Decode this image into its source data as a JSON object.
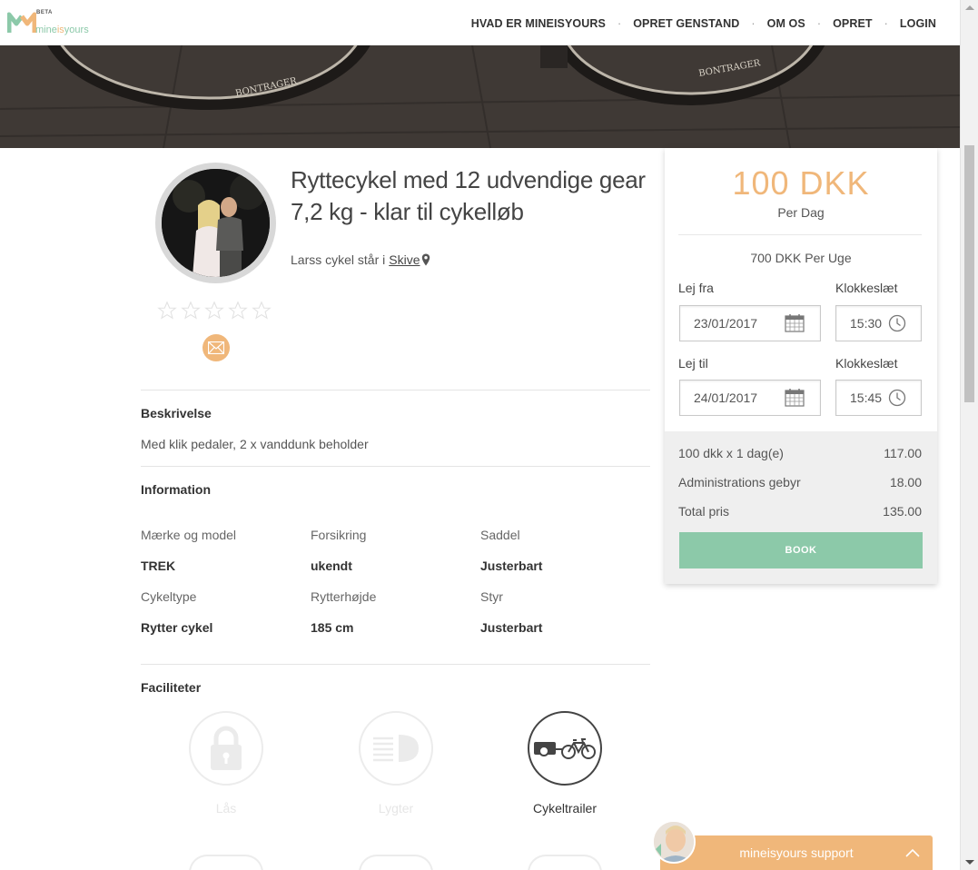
{
  "brand": {
    "beta": "BETA",
    "name_left": "mine",
    "name_mid": "is",
    "name_right": "yours"
  },
  "nav": {
    "items": [
      "HVAD ER MINEISYOURS",
      "OPRET GENSTAND",
      "OM OS",
      "OPRET",
      "LOGIN"
    ],
    "separator": "·"
  },
  "listing": {
    "title": "Ryttecykel med 12 udvendige gear 7,2 kg - klar til cykelløb",
    "owner_text": "Larss cykel står i",
    "city": "Skive",
    "rating_stars": 0,
    "rating_max": 5
  },
  "description": {
    "heading": "Beskrivelse",
    "text": "Med klik pedaler, 2 x vanddunk beholder"
  },
  "information": {
    "heading": "Information",
    "fields": [
      {
        "label": "Mærke og model",
        "value": "TREK"
      },
      {
        "label": "Forsikring",
        "value": "ukendt"
      },
      {
        "label": "Saddel",
        "value": "Justerbart"
      },
      {
        "label": "Cykeltype",
        "value": "Rytter cykel"
      },
      {
        "label": "Rytterhøjde",
        "value": "185 cm"
      },
      {
        "label": "Styr",
        "value": "Justerbart"
      }
    ]
  },
  "facilities": {
    "heading": "Faciliteter",
    "items": [
      {
        "label": "Lås",
        "active": false,
        "icon": "lock-icon"
      },
      {
        "label": "Lygter",
        "active": false,
        "icon": "headlight-icon"
      },
      {
        "label": "Cykeltrailer",
        "active": true,
        "icon": "bike-trailer-icon"
      }
    ]
  },
  "booking": {
    "price": "100 DKK",
    "per_day": "Per Dag",
    "per_week": "700 DKK Per Uge",
    "from_label": "Lej fra",
    "to_label": "Lej til",
    "time_label": "Klokkeslæt",
    "from_date": "23/01/2017",
    "from_time": "15:30",
    "to_date": "24/01/2017",
    "to_time": "15:45",
    "summary": [
      {
        "label": "100 dkk x 1 dag(e)",
        "value": "117.00"
      },
      {
        "label": "Administrations gebyr",
        "value": "18.00"
      },
      {
        "label": "Total pris",
        "value": "135.00"
      }
    ],
    "book_label": "BOOK"
  },
  "support": {
    "label": "mineisyours support"
  },
  "colors": {
    "accent": "#f0b77a",
    "green": "#8cc9a9",
    "text": "#444444"
  }
}
